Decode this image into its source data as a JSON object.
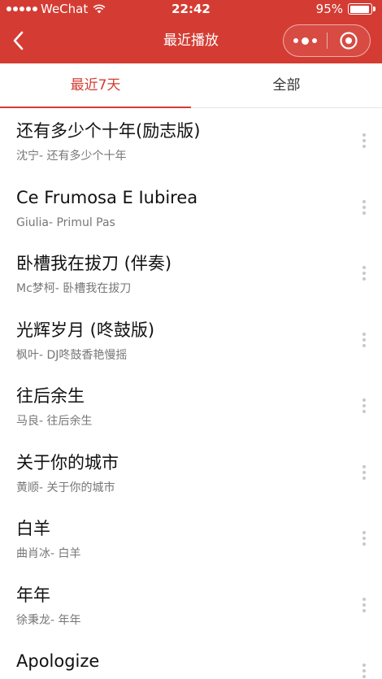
{
  "status_bar": {
    "carrier": "WeChat",
    "time": "22:42",
    "battery": "95%",
    "battery_level": 0.95,
    "icons": [
      "signal-dots-icon",
      "wifi-icon",
      "battery-icon"
    ]
  },
  "nav": {
    "title": "最近播放",
    "back_icon": "chevron-left-icon",
    "menu_icon": "more-dots-icon",
    "close_icon": "target-close-icon"
  },
  "tabs": [
    {
      "label": "最近7天",
      "active": true
    },
    {
      "label": "全部",
      "active": false
    }
  ],
  "songs": [
    {
      "title": "还有多少个十年(励志版)",
      "subtitle": "沈宁- 还有多少个十年"
    },
    {
      "title": "Ce Frumosa E Iubirea",
      "subtitle": "Giulia- Primul Pas"
    },
    {
      "title": "卧槽我在拔刀 (伴奏)",
      "subtitle": "Mc梦柯- 卧槽我在拔刀"
    },
    {
      "title": "光辉岁月 (咚鼓版)",
      "subtitle": "枫叶- DJ咚鼓香艳慢摇"
    },
    {
      "title": "往后余生",
      "subtitle": "马良- 往后余生"
    },
    {
      "title": "关于你的城市",
      "subtitle": "黄顺- 关于你的城市"
    },
    {
      "title": "白羊",
      "subtitle": "曲肖冰- 白羊"
    },
    {
      "title": "年年",
      "subtitle": "徐秉龙- 年年"
    },
    {
      "title": "Apologize",
      "subtitle": ""
    }
  ],
  "colors": {
    "accent": "#d43c33",
    "text_primary": "#111111",
    "text_secondary": "#777777",
    "divider": "#e5e5e5"
  }
}
